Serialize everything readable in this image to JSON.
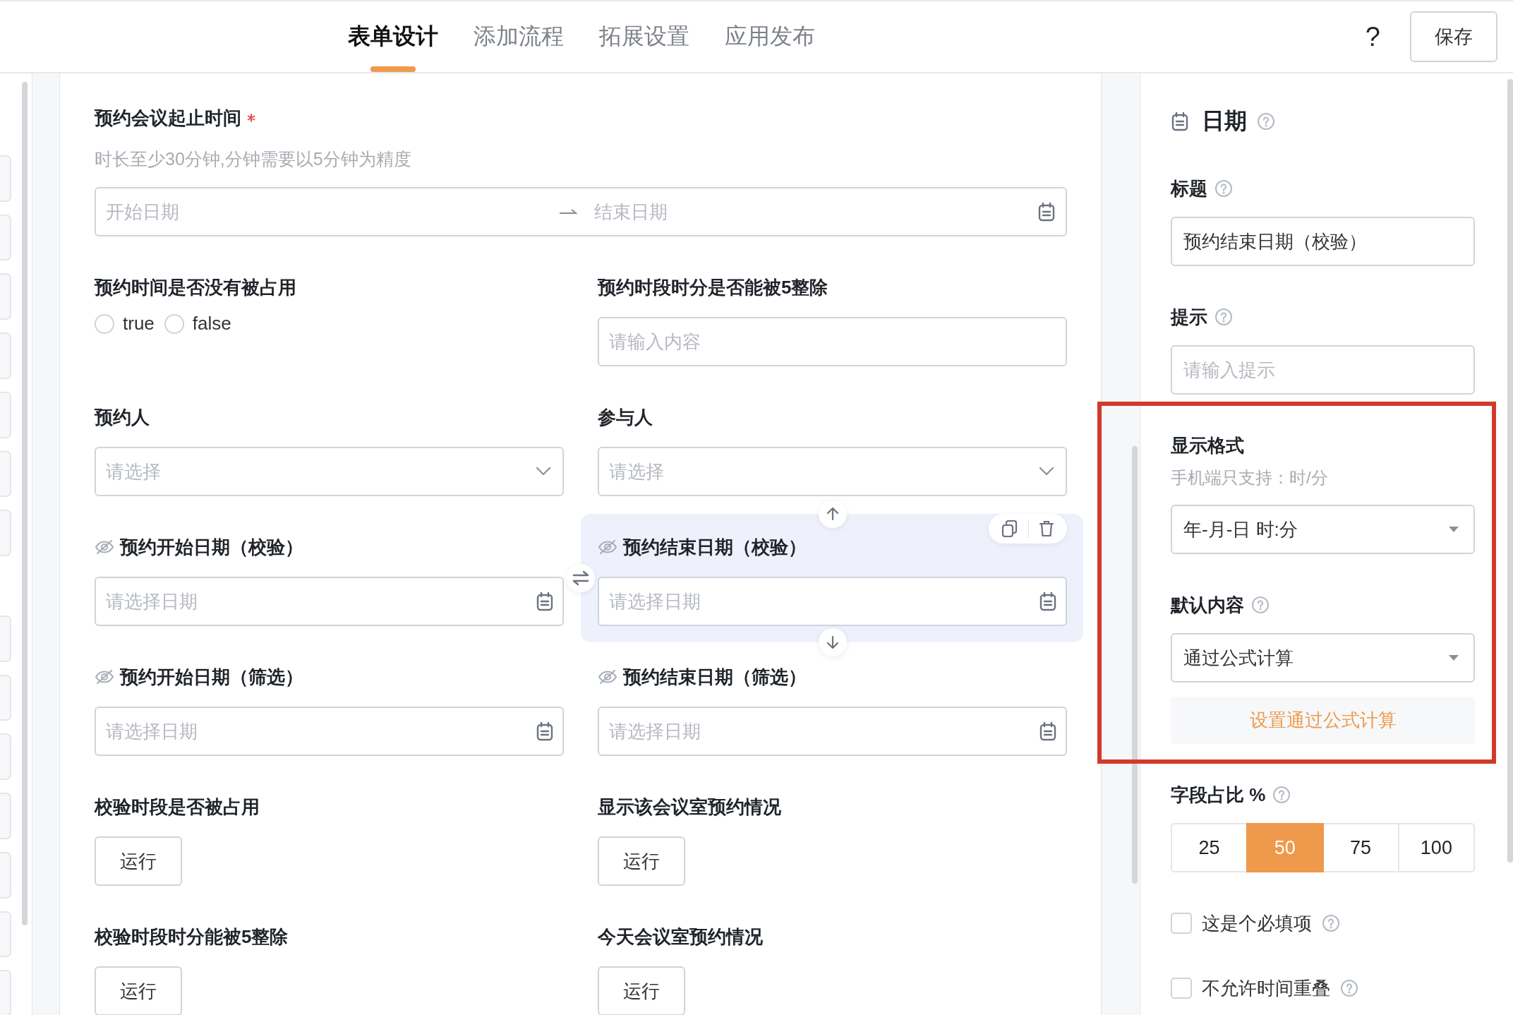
{
  "tabs": [
    {
      "label": "表单设计",
      "selected": true
    },
    {
      "label": "添加流程",
      "selected": false
    },
    {
      "label": "拓展设置",
      "selected": false
    },
    {
      "label": "应用发布",
      "selected": false
    }
  ],
  "help_button": "?",
  "save_button": "保存",
  "form": {
    "fields": [
      {
        "kind": "date_range",
        "label": "预约会议起止时间",
        "required": true,
        "hidden": false,
        "selected": false,
        "hint": "时长至少30分钟,分钟需要以5分钟为精度",
        "placeholder": "开始日期",
        "end_placeholder": "结束日期"
      },
      {
        "kind": "radio",
        "label": "预约时间是否没有被占用",
        "required": false,
        "hidden": false,
        "selected": false,
        "options": [
          {
            "label": "true",
            "selected": false
          },
          {
            "label": "false",
            "selected": false
          }
        ]
      },
      {
        "kind": "text",
        "label": "预约时段时分是否能被5整除",
        "required": false,
        "hidden": false,
        "selected": false,
        "placeholder": "请输入内容"
      },
      {
        "kind": "select",
        "label": "预约人",
        "required": false,
        "hidden": false,
        "selected": false,
        "placeholder": "请选择"
      },
      {
        "kind": "select",
        "label": "参与人",
        "required": false,
        "hidden": false,
        "selected": false,
        "placeholder": "请选择"
      },
      {
        "kind": "date",
        "label": "预约开始日期（校验）",
        "required": false,
        "hidden": true,
        "selected": false,
        "placeholder": "请选择日期"
      },
      {
        "kind": "date",
        "label": "预约结束日期（校验）",
        "required": false,
        "hidden": true,
        "selected": true,
        "placeholder": "请选择日期"
      },
      {
        "kind": "date",
        "label": "预约开始日期（筛选）",
        "required": false,
        "hidden": true,
        "selected": false,
        "placeholder": "请选择日期"
      },
      {
        "kind": "date",
        "label": "预约结束日期（筛选）",
        "required": false,
        "hidden": true,
        "selected": false,
        "placeholder": "请选择日期"
      },
      {
        "kind": "button",
        "label": "校验时段是否被占用",
        "required": false,
        "hidden": false,
        "selected": false,
        "button": "运行"
      },
      {
        "kind": "button",
        "label": "显示该会议室预约情况",
        "required": false,
        "hidden": false,
        "selected": false,
        "button": "运行"
      },
      {
        "kind": "button",
        "label": "校验时段时分能被5整除",
        "required": false,
        "hidden": false,
        "selected": false,
        "button": "运行"
      },
      {
        "kind": "button",
        "label": "今天会议室预约情况",
        "required": false,
        "hidden": false,
        "selected": false,
        "button": "运行"
      }
    ]
  },
  "properties": {
    "type": "日期",
    "sections": [
      {
        "kind": "input",
        "label": "标题",
        "help": true,
        "highlighted": false,
        "value": "预约结束日期（校验）"
      },
      {
        "kind": "input",
        "label": "提示",
        "help": true,
        "highlighted": false,
        "placeholder": "请输入提示"
      },
      {
        "kind": "select",
        "label": "显示格式",
        "help": false,
        "highlighted": true,
        "hint": "手机端只支持：时/分",
        "value": "年-月-日 时:分"
      },
      {
        "kind": "select",
        "label": "默认内容",
        "help": true,
        "highlighted": true,
        "value": "通过公式计算",
        "action": "设置通过公式计算"
      },
      {
        "kind": "segmented",
        "label": "字段占比 %",
        "help": true,
        "highlighted": false,
        "options": [
          {
            "label": "25",
            "selected": false
          },
          {
            "label": "50",
            "selected": true
          },
          {
            "label": "75",
            "selected": false
          },
          {
            "label": "100",
            "selected": false
          }
        ]
      },
      {
        "kind": "checkbox",
        "label": "这是个必填项",
        "help": true,
        "highlighted": false,
        "checked": false
      },
      {
        "kind": "checkbox",
        "label": "不允许时间重叠",
        "help": true,
        "highlighted": false,
        "checked": false
      }
    ]
  }
}
